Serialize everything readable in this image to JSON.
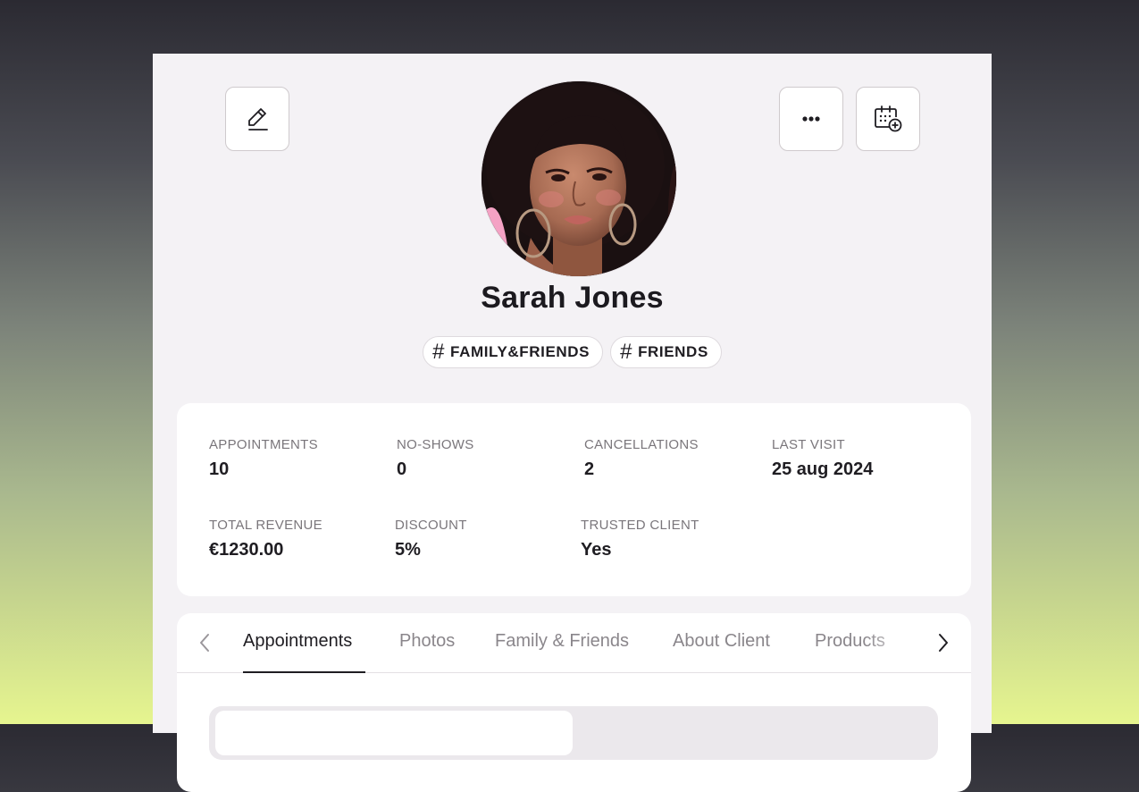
{
  "icons": {
    "edit": "pencil-edit-icon",
    "more": "more-horizontal-icon",
    "calendar": "calendar-add-icon",
    "prev": "chevron-left-icon",
    "next": "chevron-right-icon",
    "tag": "hashtag-icon"
  },
  "client": {
    "name": "Sarah Jones",
    "tags": [
      "FAMILY&FRIENDS",
      "FRIENDS"
    ]
  },
  "stats": [
    {
      "label": "APPOINTMENTS",
      "value": "10"
    },
    {
      "label": "NO-SHOWS",
      "value": "0"
    },
    {
      "label": "CANCELLATIONS",
      "value": "2"
    },
    {
      "label": "LAST VISIT",
      "value": "25 aug 2024"
    },
    {
      "label": "TOTAL REVENUE",
      "value": "€1230.00"
    },
    {
      "label": "DISCOUNT",
      "value": "5%"
    },
    {
      "label": "TRUSTED CLIENT",
      "value": "Yes"
    }
  ],
  "tabs": [
    {
      "label": "Appointments",
      "active": true
    },
    {
      "label": "Photos",
      "active": false
    },
    {
      "label": "Family & Friends",
      "active": false
    },
    {
      "label": "About Client",
      "active": false
    },
    {
      "label": "Products",
      "active": false
    }
  ],
  "colors": {
    "panel": "#f4f2f5",
    "card": "#ffffff",
    "text": "#1f1d22",
    "muted": "#7a767b",
    "inactive_tab": "#8a868b",
    "avatar_background": "#f4a2c4"
  }
}
